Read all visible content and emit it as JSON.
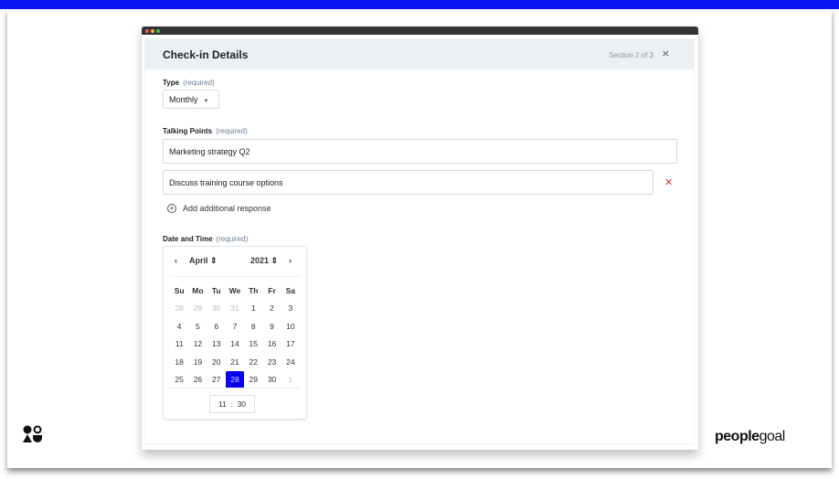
{
  "header": {
    "title": "Check-in Details",
    "section": "Section 2 of 3"
  },
  "type": {
    "label": "Type",
    "required": "(required)",
    "value": "Monthly"
  },
  "talking_points": {
    "label": "Talking Points",
    "required": "(required)",
    "responses": [
      "Marketing strategy Q2",
      "Discuss training course options"
    ],
    "add_label": "Add additional response"
  },
  "date_time": {
    "label": "Date and Time",
    "required": "(required)",
    "month": "April",
    "year": "2021",
    "weekdays": [
      "Su",
      "Mo",
      "Tu",
      "We",
      "Th",
      "Fr",
      "Sa"
    ],
    "weeks": [
      [
        "28",
        "29",
        "30",
        "31",
        "1",
        "2",
        "3"
      ],
      [
        "4",
        "5",
        "6",
        "7",
        "8",
        "9",
        "10"
      ],
      [
        "11",
        "12",
        "13",
        "14",
        "15",
        "16",
        "17"
      ],
      [
        "18",
        "19",
        "20",
        "21",
        "22",
        "23",
        "24"
      ],
      [
        "25",
        "26",
        "27",
        "28",
        "29",
        "30",
        "1"
      ]
    ],
    "selected": "28",
    "hour": "11",
    "minute": "30"
  },
  "brand": {
    "name_bold": "people",
    "name_light": "goal"
  },
  "colors": {
    "accent": "#0a00f0",
    "top_bar": "#0a14f0",
    "remove": "#dd3333"
  }
}
